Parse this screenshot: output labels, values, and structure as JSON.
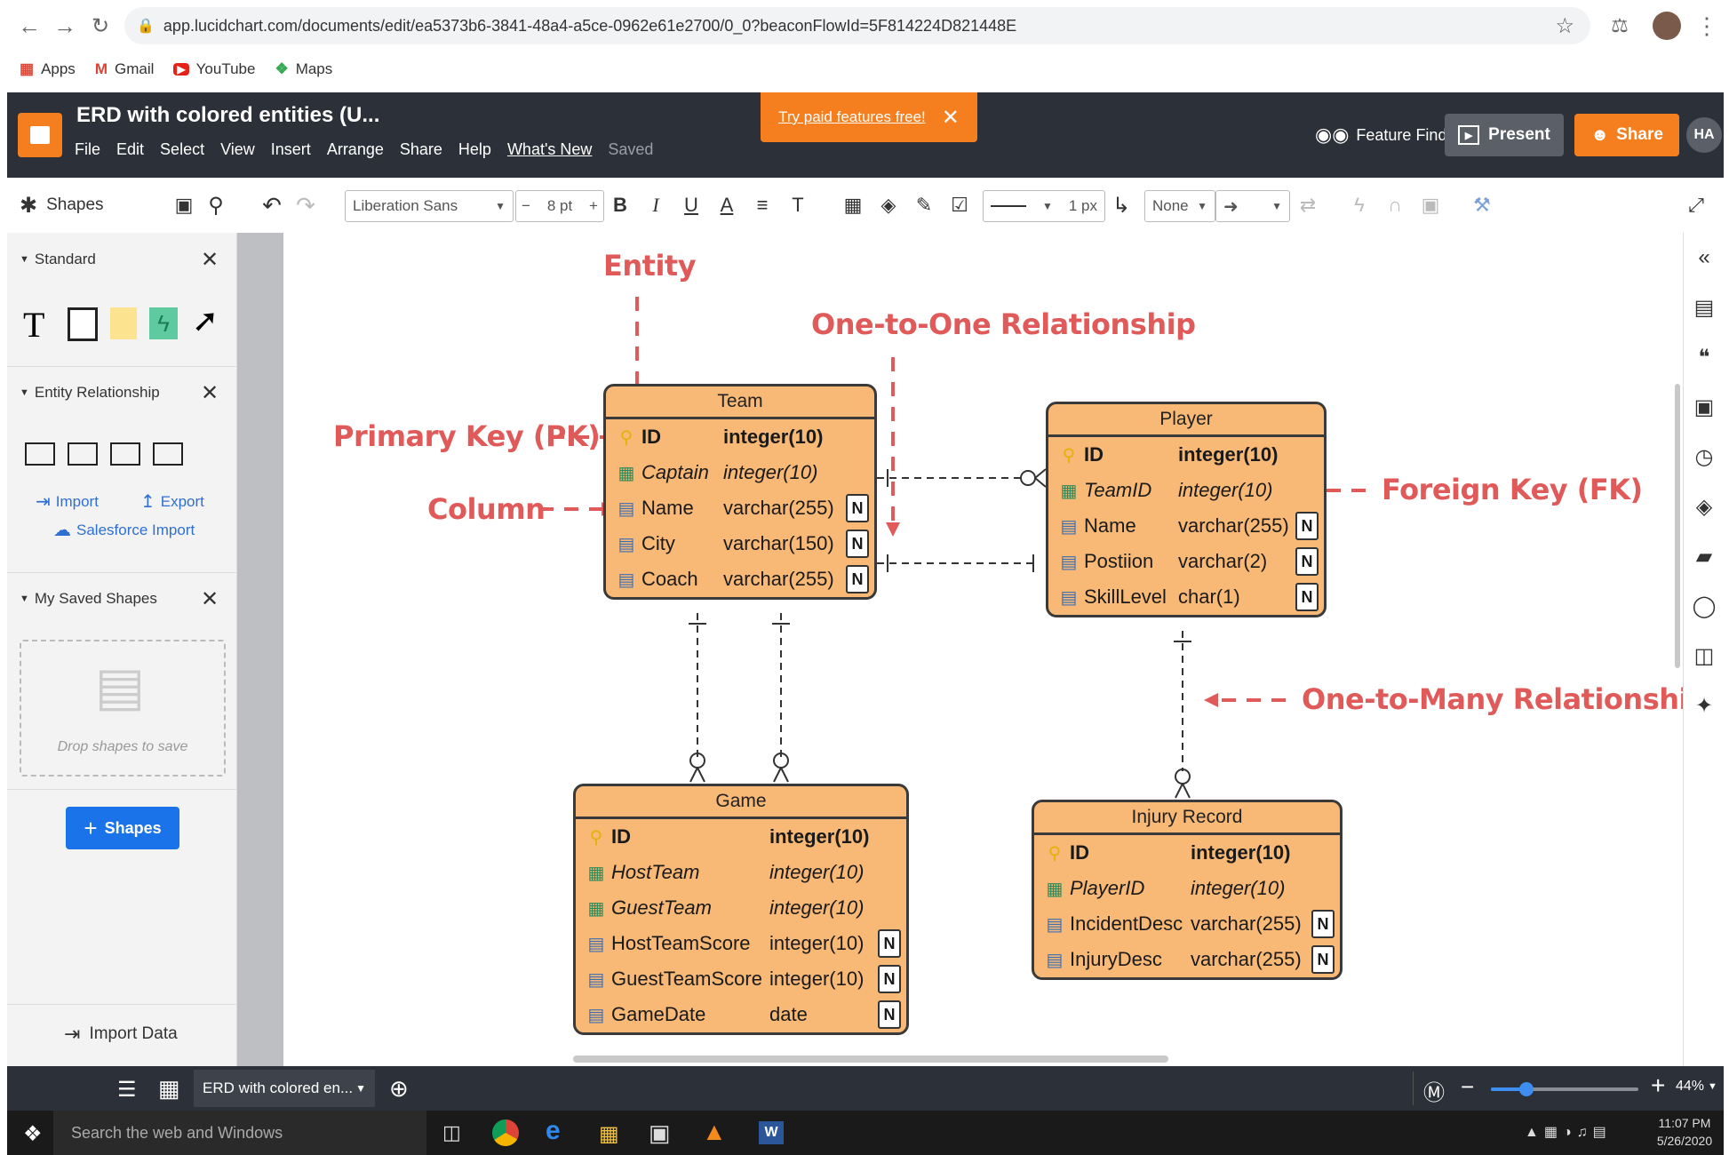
{
  "browser": {
    "url": "app.lucidchart.com/documents/edit/ea5373b6-3841-48a4-a5ce-0962e61e2700/0_0?beaconFlowId=5F814224D821448E",
    "bookmarks": [
      {
        "label": "Apps",
        "icon": "apps-grid-icon"
      },
      {
        "label": "Gmail",
        "icon": "gmail-icon"
      },
      {
        "label": "YouTube",
        "icon": "youtube-icon"
      },
      {
        "label": "Maps",
        "icon": "maps-icon"
      }
    ]
  },
  "app": {
    "doc_title": "ERD with colored entities (U...",
    "menu": [
      "File",
      "Edit",
      "Select",
      "View",
      "Insert",
      "Arrange",
      "Share",
      "Help",
      "What's New"
    ],
    "saved": "Saved",
    "promo": "Try paid features free!",
    "feature_find": "Feature Find",
    "present": "Present",
    "share": "Share",
    "avatar": "HA",
    "brand_color": "#f57e1f"
  },
  "toolbar": {
    "shapes_label": "Shapes",
    "font": "Liberation Sans",
    "font_size": "8 pt",
    "line_width": "1 px",
    "arrow_start": "None"
  },
  "leftpanel": {
    "standard": "Standard",
    "entity_relationship": "Entity Relationship",
    "import": "Import",
    "export": "Export",
    "salesforce_import": "Salesforce Import",
    "my_saved_shapes": "My Saved Shapes",
    "drop_shapes": "Drop shapes to save",
    "shapes_button": "Shapes",
    "import_data": "Import Data"
  },
  "erd": {
    "annotations": {
      "entity": "Entity",
      "one_to_one": "One-to-One Relationship",
      "primary_key": "Primary Key (PK)",
      "column": "Column",
      "foreign_key": "Foreign Key (FK)",
      "one_to_many": "One-to-Many Relationship"
    },
    "entities": {
      "team": {
        "title": "Team",
        "rows": [
          {
            "name": "ID",
            "type": "integer(10)",
            "kind": "pk",
            "nullable": ""
          },
          {
            "name": "Captain",
            "type": "integer(10)",
            "kind": "fk",
            "nullable": ""
          },
          {
            "name": "Name",
            "type": "varchar(255)",
            "kind": "col",
            "nullable": "N"
          },
          {
            "name": "City",
            "type": "varchar(150)",
            "kind": "col",
            "nullable": "N"
          },
          {
            "name": "Coach",
            "type": "varchar(255)",
            "kind": "col",
            "nullable": "N"
          }
        ]
      },
      "player": {
        "title": "Player",
        "rows": [
          {
            "name": "ID",
            "type": "integer(10)",
            "kind": "pk",
            "nullable": ""
          },
          {
            "name": "TeamID",
            "type": "integer(10)",
            "kind": "fk",
            "nullable": ""
          },
          {
            "name": "Name",
            "type": "varchar(255)",
            "kind": "col",
            "nullable": "N"
          },
          {
            "name": "Postiion",
            "type": "varchar(2)",
            "kind": "col",
            "nullable": "N"
          },
          {
            "name": "SkillLevel",
            "type": "char(1)",
            "kind": "col",
            "nullable": "N"
          }
        ]
      },
      "game": {
        "title": "Game",
        "rows": [
          {
            "name": "ID",
            "type": "integer(10)",
            "kind": "pk",
            "nullable": ""
          },
          {
            "name": "HostTeam",
            "type": "integer(10)",
            "kind": "fk",
            "nullable": ""
          },
          {
            "name": "GuestTeam",
            "type": "integer(10)",
            "kind": "fk",
            "nullable": ""
          },
          {
            "name": "HostTeamScore",
            "type": "integer(10)",
            "kind": "col",
            "nullable": "N"
          },
          {
            "name": "GuestTeamScore",
            "type": "integer(10)",
            "kind": "col",
            "nullable": "N"
          },
          {
            "name": "GameDate",
            "type": "date",
            "kind": "col",
            "nullable": "N"
          }
        ]
      },
      "injury": {
        "title": "Injury Record",
        "rows": [
          {
            "name": "ID",
            "type": "integer(10)",
            "kind": "pk",
            "nullable": ""
          },
          {
            "name": "PlayerID",
            "type": "integer(10)",
            "kind": "fk",
            "nullable": ""
          },
          {
            "name": "IncidentDesc",
            "type": "varchar(255)",
            "kind": "col",
            "nullable": "N"
          },
          {
            "name": "InjuryDesc",
            "type": "varchar(255)",
            "kind": "col",
            "nullable": "N"
          }
        ]
      }
    },
    "entity_fill": "#f8b876",
    "annotation_color": "#e05a5a"
  },
  "bottombar": {
    "page_tab": "ERD with colored en...",
    "zoom": "44%"
  },
  "taskbar": {
    "search": "Search the web and Windows",
    "time": "11:07 PM",
    "date": "5/26/2020"
  }
}
